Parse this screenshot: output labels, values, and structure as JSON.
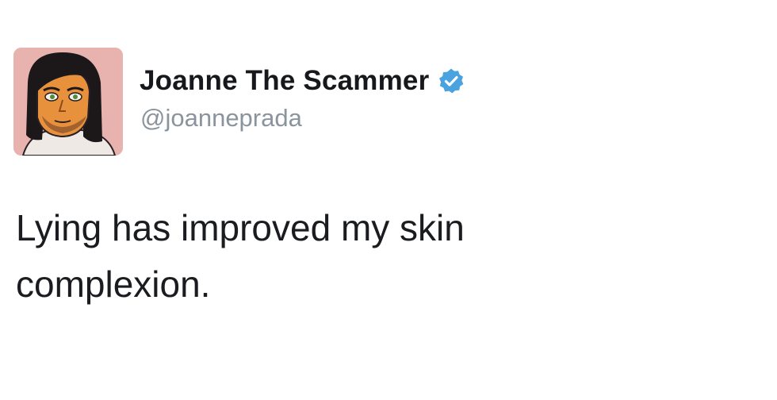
{
  "tweet": {
    "author": {
      "display_name": "Joanne The Scammer",
      "handle": "@joanneprada",
      "verified": true,
      "avatar_icon": "cartoon-portrait-avatar"
    },
    "text": "Lying has improved my skin complexion."
  },
  "colors": {
    "verified_badge": "#4aa3df",
    "handle_gray": "#8a949d",
    "avatar_background": "#e8b2ae"
  }
}
